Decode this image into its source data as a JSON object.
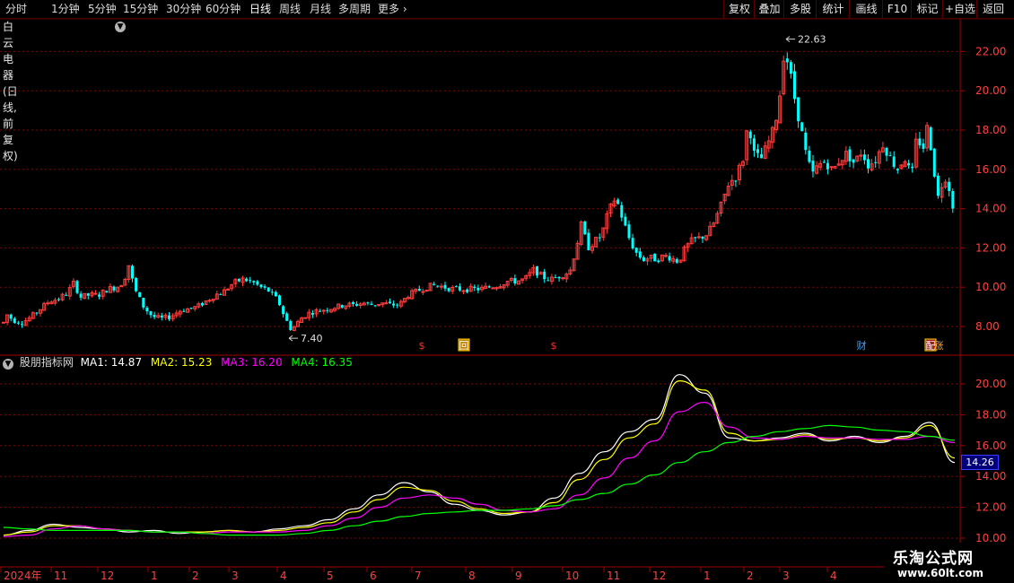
{
  "toolbar": {
    "periods": [
      "分时",
      "1分钟",
      "5分钟",
      "15分钟",
      "30分钟",
      "60分钟",
      "日线",
      "周线",
      "月线",
      "多周期",
      "更多"
    ],
    "active_period": "日线",
    "right_buttons": [
      "复权",
      "叠加",
      "多股",
      "统计",
      "画线",
      "F10",
      "标记",
      "+自选",
      "返回"
    ]
  },
  "stock": {
    "name": "白云电器(日线,前复权)"
  },
  "indicator": {
    "name": "股朋指标网",
    "ma1_label": "MA1: 14.87",
    "ma2_label": "MA2: 15.23",
    "ma3_label": "MA3: 16.20",
    "ma4_label": "MA4: 16.35",
    "ma1_color": "#ffffff",
    "ma2_color": "#ffff00",
    "ma3_color": "#ff00ff",
    "ma4_color": "#00ff00",
    "current_value": "14.26"
  },
  "colors": {
    "up": "#ff3c3c",
    "down": "#00ffff",
    "grid": "#8b0000",
    "axis_text": "#ff4040"
  },
  "watermark": {
    "title": "乐淘公式网",
    "url": "www.60lt.com"
  },
  "chart_data": [
    {
      "type": "candlestick",
      "title": "白云电器(日线,前复权)",
      "y_ticks": [
        8.0,
        10.0,
        12.0,
        14.0,
        16.0,
        18.0,
        20.0,
        22.0
      ],
      "ylim": [
        7.0,
        23.3
      ],
      "x_labels": [
        "2024年",
        "11",
        "12",
        "1",
        "2",
        "3",
        "4",
        "5",
        "6",
        "7",
        "8",
        "9",
        "10",
        "11",
        "12",
        "1",
        "2",
        "3",
        "4"
      ],
      "annotations": [
        {
          "text": "22.63",
          "kind": "high",
          "value": 22.63
        },
        {
          "text": "7.40",
          "kind": "low",
          "value": 7.4
        }
      ],
      "markers": [
        "$",
        "回",
        "$",
        "财",
        "配",
        "涨"
      ],
      "series_points": [
        {
          "x": 0,
          "y": 7.8
        },
        {
          "x": 8,
          "y": 8.6
        },
        {
          "x": 15,
          "y": 8.3
        },
        {
          "x": 25,
          "y": 8.2
        },
        {
          "x": 35,
          "y": 8.5
        },
        {
          "x": 45,
          "y": 8.9
        },
        {
          "x": 55,
          "y": 9.3
        },
        {
          "x": 65,
          "y": 9.4
        },
        {
          "x": 75,
          "y": 9.7
        },
        {
          "x": 82,
          "y": 10.2
        },
        {
          "x": 90,
          "y": 9.5
        },
        {
          "x": 100,
          "y": 9.6
        },
        {
          "x": 110,
          "y": 9.6
        },
        {
          "x": 120,
          "y": 9.9
        },
        {
          "x": 130,
          "y": 10.0
        },
        {
          "x": 138,
          "y": 10.3
        },
        {
          "x": 143,
          "y": 11.2
        },
        {
          "x": 150,
          "y": 9.9
        },
        {
          "x": 160,
          "y": 9.0
        },
        {
          "x": 170,
          "y": 8.5
        },
        {
          "x": 180,
          "y": 8.4
        },
        {
          "x": 190,
          "y": 8.5
        },
        {
          "x": 200,
          "y": 8.8
        },
        {
          "x": 210,
          "y": 8.9
        },
        {
          "x": 220,
          "y": 9.0
        },
        {
          "x": 230,
          "y": 9.3
        },
        {
          "x": 240,
          "y": 9.6
        },
        {
          "x": 250,
          "y": 9.8
        },
        {
          "x": 260,
          "y": 10.2
        },
        {
          "x": 270,
          "y": 10.4
        },
        {
          "x": 280,
          "y": 10.3
        },
        {
          "x": 290,
          "y": 10.0
        },
        {
          "x": 300,
          "y": 9.8
        },
        {
          "x": 310,
          "y": 9.3
        },
        {
          "x": 318,
          "y": 8.4
        },
        {
          "x": 325,
          "y": 7.8
        },
        {
          "x": 335,
          "y": 8.4
        },
        {
          "x": 345,
          "y": 8.7
        },
        {
          "x": 355,
          "y": 8.8
        },
        {
          "x": 365,
          "y": 8.9
        },
        {
          "x": 375,
          "y": 9.0
        },
        {
          "x": 385,
          "y": 9.1
        },
        {
          "x": 395,
          "y": 9.1
        },
        {
          "x": 405,
          "y": 9.2
        },
        {
          "x": 415,
          "y": 9.1
        },
        {
          "x": 425,
          "y": 9.2
        },
        {
          "x": 435,
          "y": 9.1
        },
        {
          "x": 445,
          "y": 9.1
        },
        {
          "x": 455,
          "y": 9.6
        },
        {
          "x": 465,
          "y": 9.8
        },
        {
          "x": 475,
          "y": 10.0
        },
        {
          "x": 485,
          "y": 10.1
        },
        {
          "x": 495,
          "y": 10.0
        },
        {
          "x": 505,
          "y": 9.9
        },
        {
          "x": 515,
          "y": 9.9
        },
        {
          "x": 525,
          "y": 9.9
        },
        {
          "x": 535,
          "y": 9.9
        },
        {
          "x": 545,
          "y": 10.0
        },
        {
          "x": 555,
          "y": 10.1
        },
        {
          "x": 565,
          "y": 10.3
        },
        {
          "x": 575,
          "y": 10.3
        },
        {
          "x": 585,
          "y": 10.4
        },
        {
          "x": 595,
          "y": 10.9
        },
        {
          "x": 605,
          "y": 10.5
        },
        {
          "x": 615,
          "y": 10.4
        },
        {
          "x": 625,
          "y": 10.6
        },
        {
          "x": 635,
          "y": 10.8
        },
        {
          "x": 642,
          "y": 12.0
        },
        {
          "x": 648,
          "y": 13.2
        },
        {
          "x": 655,
          "y": 12.0
        },
        {
          "x": 662,
          "y": 12.3
        },
        {
          "x": 670,
          "y": 12.6
        },
        {
          "x": 678,
          "y": 13.8
        },
        {
          "x": 686,
          "y": 14.6
        },
        {
          "x": 693,
          "y": 13.6
        },
        {
          "x": 700,
          "y": 12.6
        },
        {
          "x": 708,
          "y": 11.8
        },
        {
          "x": 716,
          "y": 11.4
        },
        {
          "x": 724,
          "y": 11.5
        },
        {
          "x": 732,
          "y": 11.4
        },
        {
          "x": 740,
          "y": 11.6
        },
        {
          "x": 748,
          "y": 11.5
        },
        {
          "x": 756,
          "y": 11.3
        },
        {
          "x": 764,
          "y": 12.0
        },
        {
          "x": 772,
          "y": 12.4
        },
        {
          "x": 780,
          "y": 12.5
        },
        {
          "x": 788,
          "y": 12.7
        },
        {
          "x": 796,
          "y": 13.3
        },
        {
          "x": 804,
          "y": 14.2
        },
        {
          "x": 812,
          "y": 15.3
        },
        {
          "x": 820,
          "y": 15.6
        },
        {
          "x": 828,
          "y": 16.5
        },
        {
          "x": 834,
          "y": 18.5
        },
        {
          "x": 840,
          "y": 16.8
        },
        {
          "x": 848,
          "y": 16.5
        },
        {
          "x": 855,
          "y": 17.2
        },
        {
          "x": 862,
          "y": 18.0
        },
        {
          "x": 868,
          "y": 19.3
        },
        {
          "x": 874,
          "y": 22.2
        },
        {
          "x": 880,
          "y": 21.0
        },
        {
          "x": 886,
          "y": 19.5
        },
        {
          "x": 892,
          "y": 18.2
        },
        {
          "x": 898,
          "y": 16.8
        },
        {
          "x": 905,
          "y": 15.7
        },
        {
          "x": 912,
          "y": 16.2
        },
        {
          "x": 920,
          "y": 16.4
        },
        {
          "x": 928,
          "y": 15.9
        },
        {
          "x": 936,
          "y": 16.5
        },
        {
          "x": 944,
          "y": 16.8
        },
        {
          "x": 952,
          "y": 16.3
        },
        {
          "x": 960,
          "y": 16.9
        },
        {
          "x": 968,
          "y": 16.2
        },
        {
          "x": 976,
          "y": 16.5
        },
        {
          "x": 984,
          "y": 17.3
        },
        {
          "x": 992,
          "y": 16.6
        },
        {
          "x": 1000,
          "y": 16.0
        },
        {
          "x": 1008,
          "y": 16.6
        },
        {
          "x": 1016,
          "y": 15.6
        },
        {
          "x": 1022,
          "y": 17.8
        },
        {
          "x": 1028,
          "y": 16.9
        },
        {
          "x": 1034,
          "y": 18.3
        },
        {
          "x": 1040,
          "y": 16.2
        },
        {
          "x": 1046,
          "y": 14.4
        },
        {
          "x": 1052,
          "y": 15.8
        },
        {
          "x": 1058,
          "y": 15.0
        },
        {
          "x": 1064,
          "y": 13.7
        }
      ]
    },
    {
      "type": "line",
      "title": "股朋指标网",
      "y_ticks": [
        10.0,
        12.0,
        14.0,
        16.0,
        18.0,
        20.0
      ],
      "ylim": [
        10.0,
        21.3
      ],
      "series": [
        {
          "name": "MA1",
          "color": "#ffffff",
          "values": [
            10.2,
            10.5,
            10.9,
            10.7,
            10.6,
            10.4,
            10.5,
            10.3,
            10.4,
            10.5,
            10.4,
            10.6,
            10.8,
            11.2,
            11.9,
            12.8,
            13.6,
            13.0,
            12.2,
            11.8,
            11.5,
            11.7,
            12.6,
            14.2,
            15.6,
            16.9,
            17.7,
            20.6,
            19.4,
            16.5,
            16.3,
            16.5,
            16.8,
            16.3,
            16.6,
            16.2,
            16.6,
            17.5,
            14.9
          ]
        },
        {
          "name": "MA2",
          "color": "#ffff00",
          "values": [
            10.2,
            10.4,
            10.8,
            10.8,
            10.6,
            10.5,
            10.4,
            10.4,
            10.4,
            10.5,
            10.4,
            10.5,
            10.7,
            11.0,
            11.7,
            12.5,
            13.3,
            13.1,
            12.4,
            11.9,
            11.6,
            11.7,
            12.3,
            13.8,
            15.1,
            16.5,
            17.4,
            20.2,
            19.6,
            16.8,
            16.3,
            16.4,
            16.7,
            16.4,
            16.5,
            16.3,
            16.5,
            17.3,
            15.2
          ]
        },
        {
          "name": "MA3",
          "color": "#ff00ff",
          "values": [
            10.1,
            10.2,
            10.6,
            10.8,
            10.6,
            10.5,
            10.4,
            10.4,
            10.3,
            10.4,
            10.4,
            10.4,
            10.5,
            10.8,
            11.3,
            12.0,
            12.6,
            12.8,
            12.6,
            12.2,
            11.8,
            11.7,
            11.9,
            12.8,
            13.9,
            15.2,
            16.3,
            18.2,
            18.8,
            17.2,
            16.5,
            16.4,
            16.6,
            16.5,
            16.5,
            16.4,
            16.4,
            16.6,
            16.2
          ]
        },
        {
          "name": "MA4",
          "color": "#00ff00",
          "values": [
            10.7,
            10.6,
            10.5,
            10.5,
            10.5,
            10.5,
            10.4,
            10.4,
            10.3,
            10.2,
            10.2,
            10.2,
            10.3,
            10.5,
            10.8,
            11.1,
            11.4,
            11.6,
            11.7,
            11.8,
            11.8,
            11.9,
            12.1,
            12.5,
            12.9,
            13.5,
            14.1,
            14.9,
            15.6,
            16.2,
            16.6,
            16.9,
            17.1,
            17.3,
            17.2,
            17.0,
            16.9,
            16.6,
            16.35
          ]
        }
      ]
    }
  ]
}
